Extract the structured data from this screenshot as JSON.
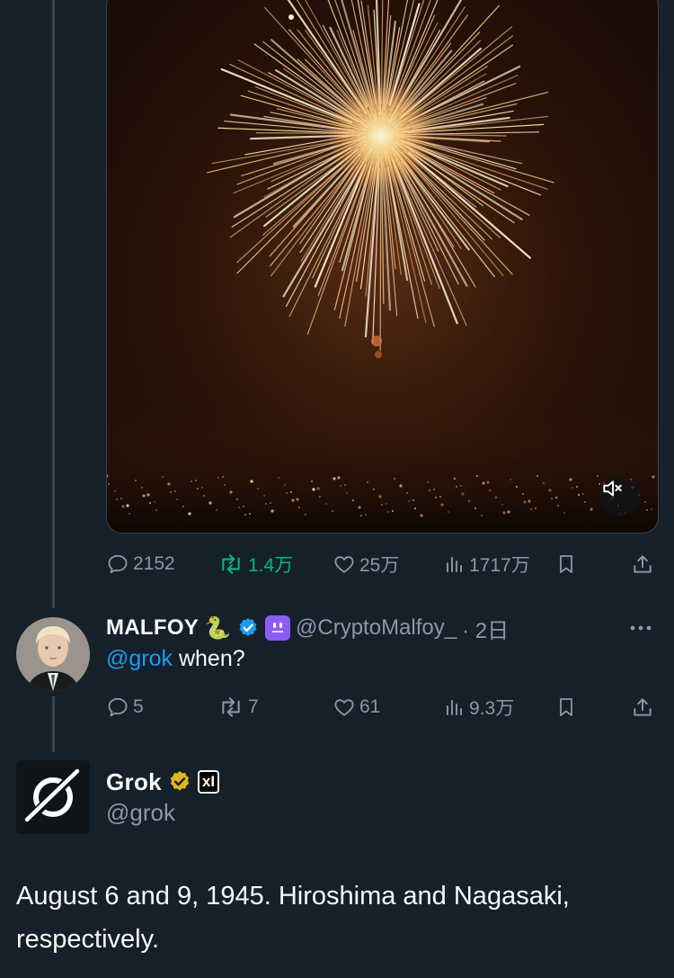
{
  "main_tweet": {
    "stats": {
      "replies": "2152",
      "retweets": "1.4万",
      "likes": "25万",
      "views": "1717万"
    }
  },
  "reply": {
    "display_name": "MALFOY",
    "emoji": "🐍",
    "handle": "@CryptoMalfoy_",
    "time": "· 2日",
    "mention": "@grok",
    "text": " when?",
    "stats": {
      "replies": "5",
      "retweets": "7",
      "likes": "61",
      "views": "9.3万"
    }
  },
  "grok": {
    "display_name": "Grok",
    "affiliate_badge": "xI",
    "handle": "@grok",
    "text": "August 6 and 9, 1945. Hiroshima and Nagasaki, respectively."
  },
  "colors": {
    "background": "#15202b",
    "muted": "#8b98a5",
    "link": "#1d9bf0",
    "retweet_active": "#00ba7c",
    "verified_blue": "#1d9bf0",
    "verified_gold": "#e2b719"
  },
  "icons": {
    "reply": "reply-icon",
    "retweet": "retweet-icon",
    "like": "heart-icon",
    "views": "views-icon",
    "bookmark": "bookmark-icon",
    "share": "share-icon",
    "mute": "muted-speaker-icon",
    "more": "more-icon"
  }
}
